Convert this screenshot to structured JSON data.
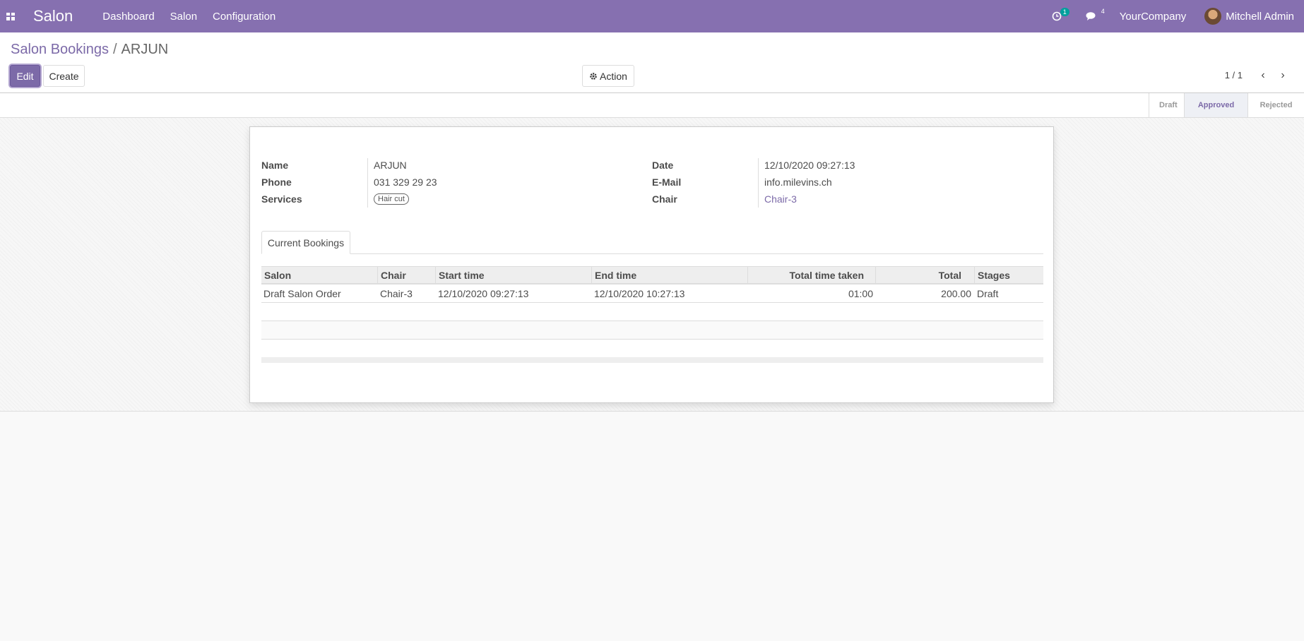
{
  "navbar": {
    "brand": "Salon",
    "menu": [
      "Dashboard",
      "Salon",
      "Configuration"
    ],
    "activity_count": "1",
    "message_count": "4",
    "company": "YourCompany",
    "user": "Mitchell Admin"
  },
  "breadcrumb": {
    "parent": "Salon Bookings",
    "separator": "/",
    "current": "ARJUN"
  },
  "buttons": {
    "edit": "Edit",
    "create": "Create",
    "action": "Action"
  },
  "pager": {
    "value": "1 / 1"
  },
  "stages": [
    "Draft",
    "Approved",
    "Rejected"
  ],
  "active_stage": "Approved",
  "form": {
    "name_label": "Name",
    "name": "ARJUN",
    "phone_label": "Phone",
    "phone": "031 329 29 23",
    "services_label": "Services",
    "services": [
      "Hair cut"
    ],
    "date_label": "Date",
    "date": "12/10/2020 09:27:13",
    "email_label": "E-Mail",
    "email": "info.milevins.ch",
    "chair_label": "Chair",
    "chair": "Chair-3"
  },
  "tab": {
    "label": "Current Bookings"
  },
  "table": {
    "columns": [
      "Salon",
      "Chair",
      "Start time",
      "End time",
      "Total time taken",
      "Total",
      "Stages"
    ],
    "rows": [
      [
        "Draft Salon Order",
        "Chair-3",
        "12/10/2020 09:27:13",
        "12/10/2020 10:27:13",
        "01:00",
        "200.00",
        "Draft"
      ]
    ]
  },
  "colors": {
    "brand": "#8670b0",
    "link": "#7c6aa8"
  }
}
